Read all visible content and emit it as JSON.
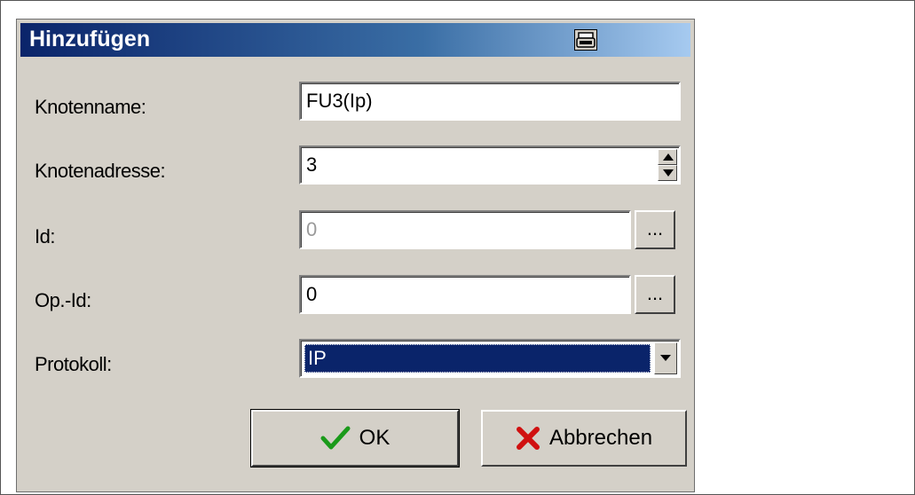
{
  "dialog": {
    "title": "Hinzufügen",
    "title_icon": "keyboard-icon"
  },
  "fields": {
    "knotenname": {
      "label": "Knotenname:",
      "value": "FU3(Ip)"
    },
    "knotenadresse": {
      "label": "Knotenadresse:",
      "value": "3"
    },
    "id": {
      "label": "Id:",
      "value": "0",
      "browse_label": "..."
    },
    "op_id": {
      "label": "Op.-Id:",
      "value": "0",
      "browse_label": "..."
    },
    "protokoll": {
      "label": "Protokoll:",
      "selected": "IP"
    }
  },
  "buttons": {
    "ok": {
      "label": "OK",
      "icon": "checkmark-icon",
      "color": "#1a9a1a"
    },
    "cancel": {
      "label": "Abbrechen",
      "icon": "x-icon",
      "color": "#d01010"
    }
  }
}
